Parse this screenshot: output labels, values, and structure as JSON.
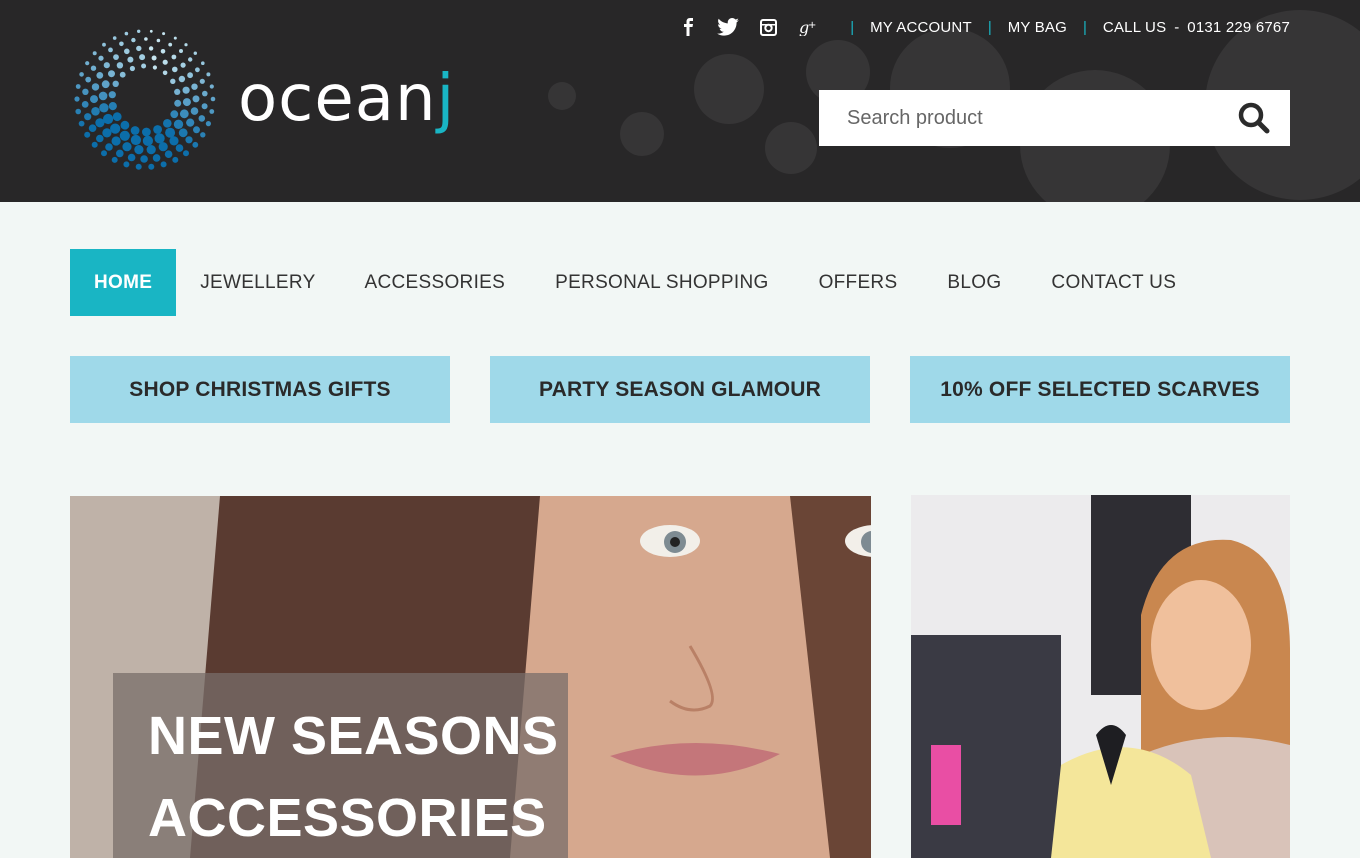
{
  "brand": {
    "name_main": "ocean",
    "name_accent": "j",
    "accent_color": "#19b5c4"
  },
  "topbar": {
    "social": [
      "facebook-icon",
      "twitter-icon",
      "instagram-icon",
      "google-plus-icon"
    ],
    "my_account": "MY ACCOUNT",
    "my_bag": "MY BAG",
    "call_us_label": "CALL US",
    "call_us_sep": "-",
    "phone": "0131 229 6767",
    "separator": "|"
  },
  "search": {
    "placeholder": "Search product",
    "icon": "search-icon"
  },
  "nav": {
    "items": [
      "HOME",
      "JEWELLERY",
      "ACCESSORIES",
      "PERSONAL SHOPPING",
      "OFFERS",
      "BLOG",
      "CONTACT US"
    ],
    "active": "HOME"
  },
  "promos": [
    "SHOP CHRISTMAS GIFTS",
    "PARTY SEASON GLAMOUR",
    "10% OFF SELECTED SCARVES"
  ],
  "hero": {
    "line1": "NEW SEASONS",
    "line2": "ACCESSORIES"
  },
  "colors": {
    "header_bg": "#282728",
    "page_bg": "#f2f7f5",
    "promo_bg": "#9fd9e9",
    "accent": "#19b5c4"
  }
}
